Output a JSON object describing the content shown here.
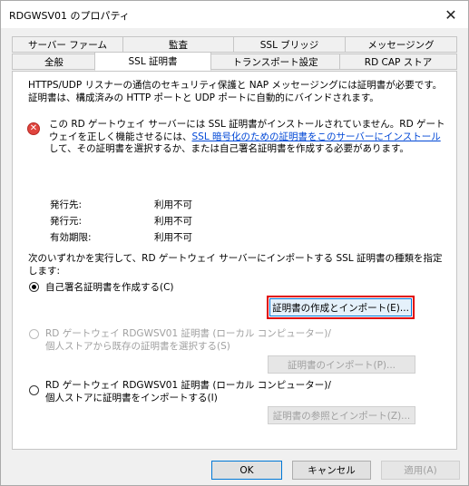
{
  "window": {
    "title": "RDGWSV01 のプロパティ",
    "close_glyph": "✕"
  },
  "tabs": {
    "row1": [
      "サーバー ファーム",
      "監査",
      "SSL ブリッジ",
      "メッセージング"
    ],
    "row2": [
      "全般",
      "SSL 証明書",
      "トランスポート設定",
      "RD CAP ストア"
    ],
    "selected": "SSL 証明書"
  },
  "panel": {
    "description": "HTTPS/UDP リスナーの通信のセキュリティ保護と NAP メッセージングには証明書が必要です。証明書は、構成済みの HTTP ポートと UDP ポートに自動的にバインドされます。",
    "error_glyph": "✕",
    "warning_before": "この RD ゲートウェイ サーバーには SSL 証明書がインストールされていません。RD ゲートウェイを正しく機能させるには、",
    "warning_link": "SSL 暗号化のための証明書をこのサーバーにインストール",
    "warning_after": "して、その証明書を選択するか、または自己署名証明書を作成する必要があります。",
    "info": [
      {
        "label": "発行先:",
        "value": "利用不可"
      },
      {
        "label": "発行元:",
        "value": "利用不可"
      },
      {
        "label": "有効期限:",
        "value": "利用不可"
      }
    ],
    "instruction": "次のいずれかを実行して、RD ゲートウェイ サーバーにインポートする SSL 証明書の種類を指定します:",
    "option1_label": "自己署名証明書を作成する(C)",
    "option1_button": "証明書の作成とインポート(E)...",
    "option2_label_line1": "RD ゲートウェイ RDGWSV01 証明書 (ローカル コンピューター)/",
    "option2_label_line2": "個人ストアから既存の証明書を選択する(S)",
    "option2_button": "証明書のインポート(P)...",
    "option3_label_line1": "RD ゲートウェイ RDGWSV01 証明書 (ローカル コンピューター)/",
    "option3_label_line2": "個人ストアに証明書をインポートする(I)",
    "option3_button": "証明書の参照とインポート(Z)..."
  },
  "footer": {
    "ok": "OK",
    "cancel": "キャンセル",
    "apply": "適用(A)"
  },
  "colors": {
    "link": "#0047d6",
    "highlight": "#e00000",
    "error": "#e0443e"
  }
}
